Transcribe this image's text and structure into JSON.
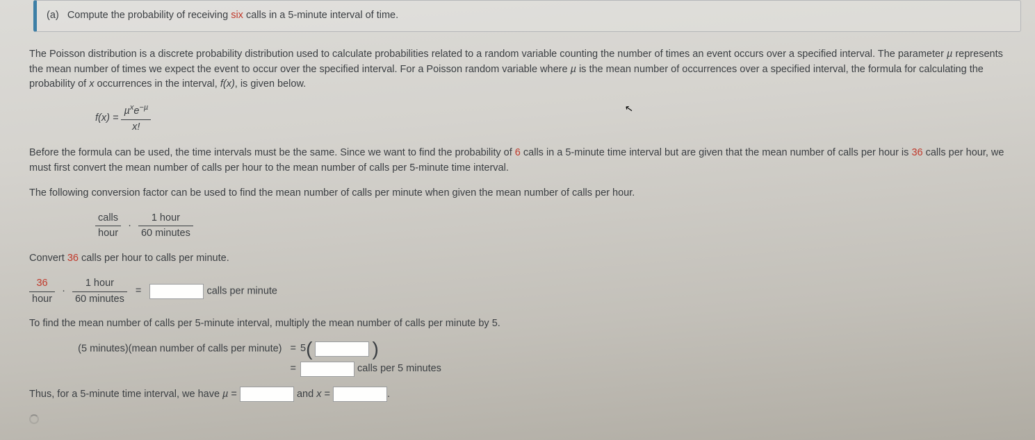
{
  "header": {
    "part": "(a)",
    "text1": "Compute the probability of receiving ",
    "highlight": "six",
    "text2": " calls in a 5-minute interval of time."
  },
  "p1": {
    "t1": "The Poisson distribution is a discrete probability distribution used to calculate probabilities related to a random variable counting the number of times an event occurs over a specified interval. The parameter ",
    "mu1": "µ",
    "t2": " represents the mean number of times we expect the event to occur over the specified interval. For a Poisson random variable where ",
    "mu2": "µ",
    "t3": " is the mean number of occurrences over a specified interval, the formula for calculating the probability of ",
    "x": "x",
    "t4": " occurrences in the interval, ",
    "fx": "f(x)",
    "t5": ", is given below."
  },
  "formula": {
    "lhs": "f(x) = ",
    "num": "µ",
    "supx": "x",
    "e": "e",
    "supneg": "−µ",
    "den": "x!"
  },
  "p2": {
    "t1": "Before the formula can be used, the time intervals must be the same. Since we want to find the probability of ",
    "h1": "6",
    "t2": " calls in a 5-minute time interval but are given that the mean number of calls per hour is ",
    "h2": "36",
    "t3": " calls per hour, we must first convert the mean number of calls per hour to the mean number of calls per 5-minute time interval."
  },
  "p3": "The following conversion factor can be used to find the mean number of calls per minute when given the mean number of calls per hour.",
  "conv": {
    "n1": "calls",
    "d1": "hour",
    "n2": "1 hour",
    "d2": "60 minutes"
  },
  "p4": {
    "t1": "Convert ",
    "h": "36",
    "t2": " calls per hour to calls per minute."
  },
  "eq1": {
    "n1": "36",
    "d1": "hour",
    "n2": "1 hour",
    "d2": "60 minutes",
    "unit": " calls per minute"
  },
  "p5": "To find the mean number of calls per 5-minute interval, multiply the mean number of calls per minute by 5.",
  "eq2": {
    "lhs": "(5 minutes)(mean number of calls per minute)",
    "five": "5",
    "unit": " calls per 5 minutes"
  },
  "p6": {
    "t1": "Thus, for a 5-minute time interval, we have ",
    "mu": "µ",
    "eq": " = ",
    "and": " and ",
    "x": "x",
    "eq2": " = ",
    "dot": "."
  }
}
